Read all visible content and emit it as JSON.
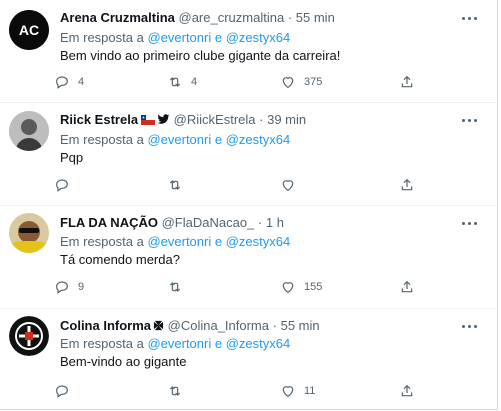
{
  "common": {
    "replying_prefix": "Em resposta a",
    "mention1": "@evertonri",
    "and": "e",
    "mention2": "@zestyx64",
    "dot": "·"
  },
  "replies": [
    {
      "name": "Arena Cruzmaltina",
      "handle": "@are_cruzmaltina",
      "time": "55 min",
      "text": "Bem vindo ao primeiro clube gigante da carreira!",
      "reply_count": "4",
      "retweet_count": "4",
      "like_count": "375",
      "avatar_text": "AC",
      "avatar_bg": "#0a0a0a"
    },
    {
      "name": "Riick Estrela",
      "handle": "@RiickEstrela",
      "time": "39 min",
      "text": "Pqp",
      "reply_count": "",
      "retweet_count": "",
      "like_count": "",
      "flag_icon": "chile-flag-icon",
      "verified_icon": "twitter-bird-icon"
    },
    {
      "name": "FLA DA NAÇÃO",
      "handle": "@FlaDaNacao_",
      "time": "1 h",
      "text": "Tá comendo merda?",
      "reply_count": "9",
      "retweet_count": "",
      "like_count": "155"
    },
    {
      "name": "Colina Informa",
      "handle": "@Colina_Informa",
      "time": "55 min",
      "text": "Bem-vindo ao gigante",
      "reply_count": "",
      "retweet_count": "",
      "like_count": "11",
      "cross_icon": "maltese-cross-icon"
    }
  ],
  "colors": {
    "accent": "#1d9bf0",
    "secondary_text": "#536471",
    "divider": "#eff3f4"
  }
}
